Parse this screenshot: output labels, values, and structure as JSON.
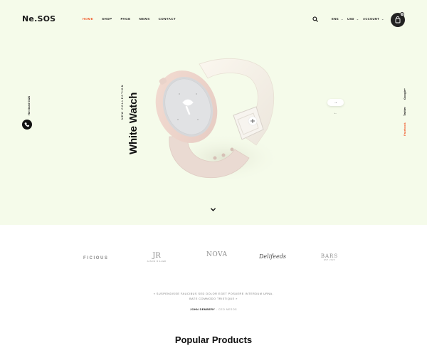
{
  "header": {
    "logo": "Ne.SOS",
    "nav": [
      "HOME",
      "SHOP",
      "PAGE",
      "NEWS",
      "CONTACT"
    ],
    "nav_active_index": 0,
    "language": "ENG",
    "currency": "USD",
    "account": "ACCOUNT",
    "cart_count": "0"
  },
  "hero": {
    "phone": "Hot lined 0326",
    "collection_label": "NEW COLLECTION",
    "title": "White Watch",
    "slide_next": "→",
    "slide_prev": "←",
    "social": [
      "Google+",
      "Twitter",
      "Facebook"
    ],
    "social_active_index": 2,
    "scroll_down": "⌄",
    "background": "#f5fbea"
  },
  "brands": [
    "FICIOUS",
    "JR",
    "NOVA",
    "Delifeeds",
    "BARS"
  ],
  "brand_sublabels": {
    "JR": "JASON RILLER",
    "BARS": "EST 2020"
  },
  "testimonial": {
    "quote": "« SUSPENDISSE FAUCIBUS SED DOLOR EGET POSUERE INTERDUM URNA, BATE COMMODO TRISTIQUE »",
    "author_name": "JOHN DEMBERY",
    "author_sep": " - ",
    "author_role": "CEO NESOS"
  },
  "section": {
    "title": "Popular Products"
  },
  "colors": {
    "accent": "#f15a2b",
    "dark": "#111111"
  }
}
